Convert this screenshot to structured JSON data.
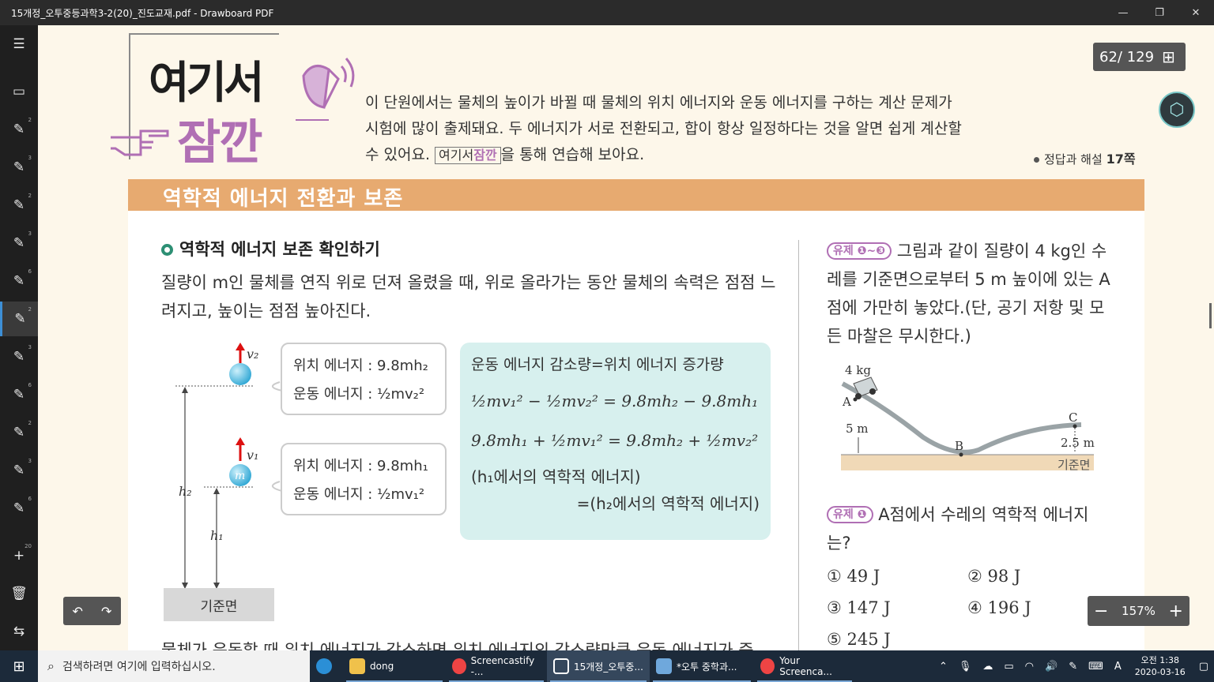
{
  "window": {
    "title": "15개정_오투중등과학3-2(20)_진도교재.pdf - Drawboard PDF",
    "minimize": "—",
    "restore": "❐",
    "close": "✕"
  },
  "sidebar": {
    "items": [
      {
        "name": "menu-icon",
        "glyph": "☰",
        "num": ""
      },
      {
        "name": "folder-icon",
        "glyph": "▭",
        "num": ""
      },
      {
        "name": "pen-icon",
        "glyph": "✎",
        "num": "2"
      },
      {
        "name": "pen-icon",
        "glyph": "✎",
        "num": "3"
      },
      {
        "name": "pen-icon",
        "glyph": "✎",
        "num": "2"
      },
      {
        "name": "pen-icon",
        "glyph": "✎",
        "num": "3"
      },
      {
        "name": "pen-icon",
        "glyph": "✎",
        "num": "6"
      },
      {
        "name": "pen-icon",
        "glyph": "✎",
        "num": "2"
      },
      {
        "name": "pen-icon",
        "glyph": "✎",
        "num": "3"
      },
      {
        "name": "pen-icon",
        "glyph": "✎",
        "num": "6"
      },
      {
        "name": "pen-icon",
        "glyph": "✎",
        "num": "2"
      },
      {
        "name": "pen-icon",
        "glyph": "✎",
        "num": "3"
      },
      {
        "name": "pen-icon",
        "glyph": "✎",
        "num": "6"
      },
      {
        "name": "add-icon",
        "glyph": "+",
        "num": "20"
      },
      {
        "name": "trash-icon",
        "glyph": "🗑",
        "num": ""
      },
      {
        "name": "swap-icon",
        "glyph": "⇆",
        "num": ""
      }
    ]
  },
  "doc": {
    "logo_top": "여기서",
    "logo_bottom": "잠깐",
    "intro_1": "이 단원에서는 물체의 높이가 바뀔 때 물체의 위치 에너지와 운동 에너지를 구하는 계산 문제가",
    "intro_2": "시험에 많이 출제돼요. 두 에너지가 서로 전환되고, 합이 항상 일정하다는 것을 알면 쉽게 계산할",
    "intro_3a": "수 있어요.",
    "intro_logo_a": "여기서",
    "intro_logo_b": "잠깐",
    "intro_3b": "을 통해 연습해 보아요.",
    "answer_ref": "정답과 해설",
    "answer_page": "17쪽",
    "banner": "역학적 에너지 전환과 보존",
    "section_heading": "역학적 에너지 보존 확인하기",
    "section_body": "질량이 m인 물체를 연직 위로 던져 올렸을 때, 위로 올라가는 동안 물체의 속력은 점점 느려지고, 높이는 점점 높아진다.",
    "box1_pe": "위치 에너지 : 9.8mh₂",
    "box1_ke": "운동 에너지 : ½mv₂²",
    "box2_pe": "위치 에너지 : 9.8mh₁",
    "box2_ke": "운동 에너지 : ½mv₁²",
    "f_title": "운동 에너지 감소량=위치 에너지 증가량",
    "f_line1": "½mv₁² − ½mv₂² = 9.8mh₂ − 9.8mh₁",
    "f_line2": "9.8mh₁ + ½mv₁² = 9.8mh₂ + ½mv₂²",
    "f_line3": "(h₁에서의 역학적 에너지)",
    "f_line4": "=(h₂에서의 역학적 에너지)",
    "diag_v2": "v₂",
    "diag_v1": "v₁",
    "diag_m": "m",
    "diag_h2": "h₂",
    "diag_h1": "h₁",
    "base": "기준면",
    "cut_text": "물체가 운동할 때 위치 에너지가 감소하면 위치 에너지의 감소량만큼 운동 에너지가 증",
    "q_tag": "유제 ❶~❸",
    "q_body": "그림과 같이 질량이 4 kg인 수레를 기준면으로부터 5 m 높이에 있는 A점에 가만히 놓았다.(단, 공기 저항 및 모든 마찰은 무시한다.)",
    "fig_mass": "4 kg",
    "fig_a": "A",
    "fig_b": "B",
    "fig_c": "C",
    "fig_5m": "5 m",
    "fig_25m": "2.5 m",
    "fig_base": "기준면",
    "q1_tag": "유제 ❶",
    "q1_body": "A점에서 수레의 역학적 에너지는?",
    "choices": [
      "① 49 J",
      "② 98 J",
      "③ 147 J",
      "④ 196 J",
      "⑤ 245 J"
    ]
  },
  "viewer": {
    "page_counter": "62/ 129",
    "zoom": "157%",
    "zoom_minus": "−",
    "zoom_plus": "+",
    "undo": "↶",
    "redo": "↷"
  },
  "taskbar": {
    "search_placeholder": "검색하려면 여기에 입력하십시오.",
    "items": [
      "dong",
      "Screencastify -...",
      "15개정_오투중...",
      "*오투 중학과...",
      "Your Screenca..."
    ],
    "ime": "A",
    "time": "오전 1:38",
    "date": "2020-03-16"
  },
  "colors": {
    "accent_purple": "#b06fb4",
    "banner_orange": "#e7aa70",
    "formula_bg": "#d7f0ee",
    "ball": "#2fa7d4"
  }
}
